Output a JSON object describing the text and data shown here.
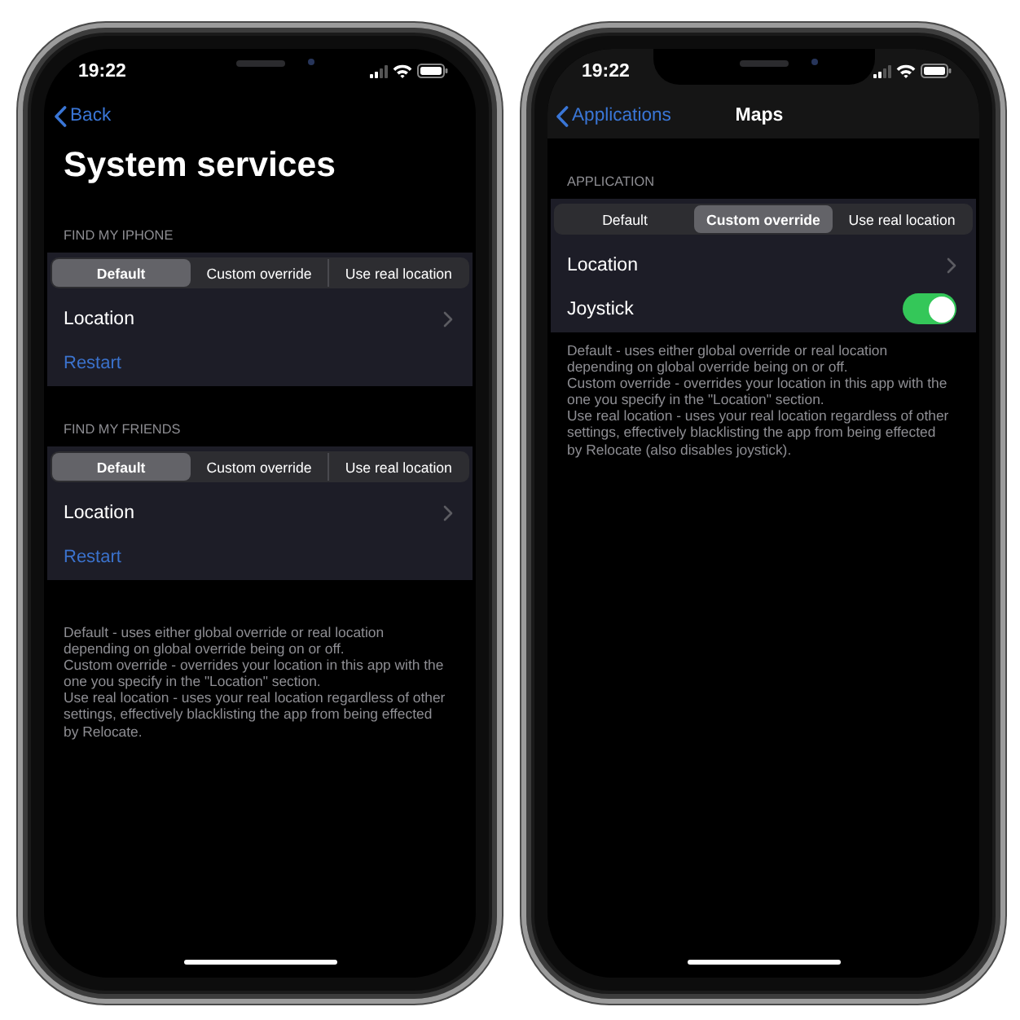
{
  "phones": [
    {
      "kind": "large_title",
      "status_bar": {
        "time": "19:22"
      },
      "nav_bar": {
        "back": "Back",
        "title": "System services"
      },
      "sections": [
        {
          "header": "FIND MY IPHONE",
          "segments": [
            {
              "label": "Default",
              "selected": true
            },
            {
              "label": "Custom override",
              "selected": false
            },
            {
              "label": "Use real location",
              "selected": false
            }
          ],
          "rows": [
            {
              "kind": "disclosure",
              "label": "Location"
            },
            {
              "kind": "action",
              "label": "Restart"
            }
          ]
        },
        {
          "header": "FIND MY FRIENDS",
          "segments": [
            {
              "label": "Default",
              "selected": true
            },
            {
              "label": "Custom override",
              "selected": false
            },
            {
              "label": "Use real location",
              "selected": false
            }
          ],
          "rows": [
            {
              "kind": "disclosure",
              "label": "Location"
            },
            {
              "kind": "action",
              "label": "Restart"
            }
          ]
        }
      ],
      "footer": [
        "Default - uses either global override or real location depending on global override being on or off.",
        "Custom override - overrides your location in this app with the one you specify in the \"Location\" section.",
        "Use real location - uses your real location regardless of other settings, effectively blacklisting the app from being effected by Relocate."
      ]
    },
    {
      "kind": "inline_title",
      "status_bar": {
        "time": "19:22"
      },
      "nav_bar": {
        "back": "Applications",
        "title": "Maps"
      },
      "sections": [
        {
          "header": "APPLICATION",
          "segments": [
            {
              "label": "Default",
              "selected": false
            },
            {
              "label": "Custom override",
              "selected": true
            },
            {
              "label": "Use real location",
              "selected": false
            }
          ],
          "rows": [
            {
              "kind": "disclosure",
              "label": "Location"
            },
            {
              "kind": "toggle",
              "label": "Joystick",
              "on": true
            }
          ]
        }
      ],
      "footer": [
        "Default - uses either global override or real location depending on global override being on or off.",
        "Custom override - overrides your location in this app with the one you specify in the \"Location\" section.",
        "Use real location - uses your real location regardless of other settings, effectively blacklisting the app from being effected by Relocate (also disables joystick)."
      ]
    }
  ]
}
